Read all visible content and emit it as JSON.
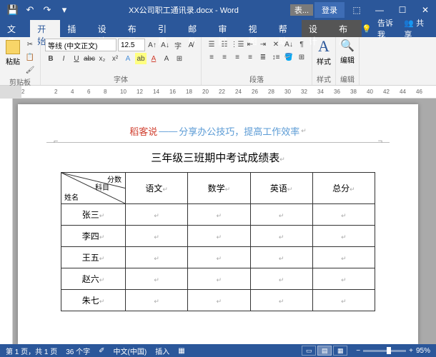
{
  "title": "XX公司职工通讯录.docx - Word",
  "qat": {
    "save": "💾",
    "undo": "↶",
    "redo": "↷",
    "more": "▾"
  },
  "table_tools": "表...",
  "login": "登录",
  "win": {
    "min": "—",
    "max": "☐",
    "close": "✕"
  },
  "tabs": {
    "file": "文件",
    "home": "开始",
    "insert": "插入",
    "design": "设计",
    "layout": "布局",
    "references": "引用",
    "mail": "邮件",
    "review": "审阅",
    "view": "视图",
    "help": "帮助",
    "t_design": "设计",
    "t_layout": "布局",
    "tell_me": "告诉我",
    "share": "共享"
  },
  "ribbon": {
    "clipboard": {
      "paste": "粘贴",
      "label": "剪贴板"
    },
    "font": {
      "name": "等线 (中文正文)",
      "size": "12.5",
      "bold": "B",
      "italic": "I",
      "underline": "U",
      "strike": "abc",
      "sub": "x₂",
      "sup": "x²",
      "label": "字体"
    },
    "paragraph": {
      "label": "段落"
    },
    "styles": {
      "label": "样式",
      "btn": "样式"
    },
    "editing": {
      "label": "编辑",
      "btn": "编辑"
    }
  },
  "ruler_ticks": [
    "2",
    "",
    "2",
    "4",
    "6",
    "8",
    "10",
    "12",
    "14",
    "16",
    "18",
    "20",
    "22",
    "24",
    "26",
    "28",
    "30",
    "32",
    "34",
    "36",
    "38",
    "40",
    "42",
    "44",
    "46"
  ],
  "doc": {
    "header_red": "稻客说",
    "header_dash": "——",
    "header_blue": "分享办公技巧，提高工作效率",
    "title": "三年级三班期中考试成绩表",
    "diag": {
      "top": "分数",
      "mid": "科目",
      "bot": "姓名"
    },
    "cols": [
      "语文",
      "数学",
      "英语",
      "总分"
    ],
    "rows": [
      "张三",
      "李四",
      "王五",
      "赵六",
      "朱七"
    ]
  },
  "status": {
    "page": "第 1 页，共 1 页",
    "words": "36 个字",
    "lang_icon": "✐",
    "lang": "中文(中国)",
    "mode": "插入",
    "macro": "▦",
    "zoom_minus": "−",
    "zoom_plus": "+",
    "zoom": "95%"
  }
}
